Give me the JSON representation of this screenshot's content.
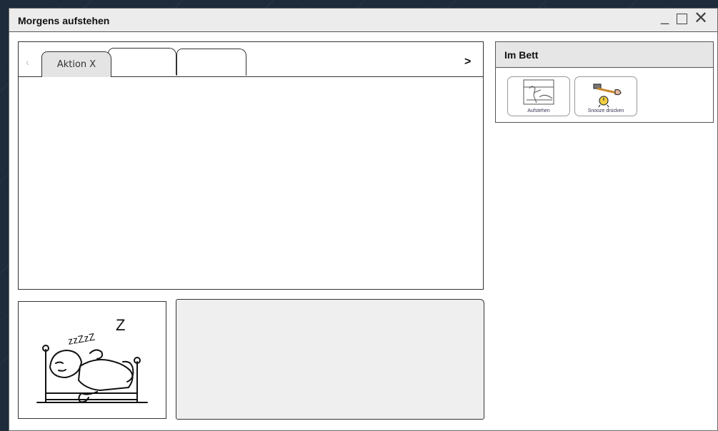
{
  "window": {
    "title": "Morgens aufstehen",
    "minimize_glyph": "_",
    "close_glyph": "✕"
  },
  "tabs": {
    "prev_glyph": "‹",
    "next_glyph": ">",
    "items": [
      {
        "label": "Aktion X",
        "active": true
      },
      {
        "label": "",
        "active": false
      },
      {
        "label": "",
        "active": false
      }
    ]
  },
  "side_panel": {
    "title": "Im Bett",
    "actions": [
      {
        "label": "Aufstehen",
        "icon": "person-getting-out-of-bed-icon"
      },
      {
        "label": "Snooze drücken",
        "icon": "hammer-alarm-clock-icon"
      }
    ]
  },
  "avatar": {
    "icon": "sleeping-person-in-bed-icon",
    "snore_text": "zzZzZ"
  },
  "colors": {
    "background": "#1d2b3a",
    "titlebar": "#ececec",
    "active_tab": "#e4e4e4",
    "detail_panel": "#efefef"
  }
}
